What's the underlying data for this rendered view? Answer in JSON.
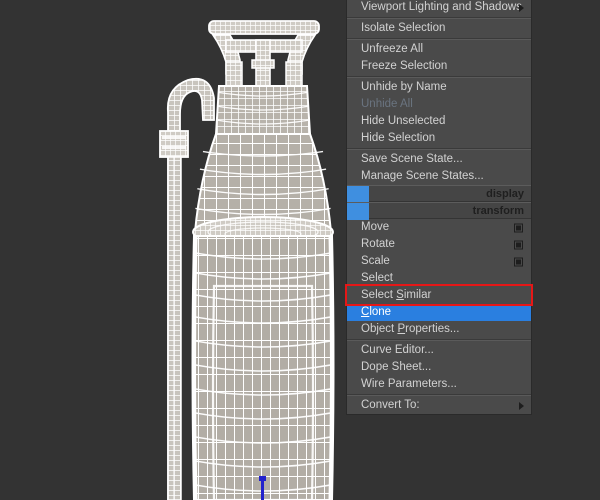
{
  "app": {
    "background_color": "#333333",
    "viewport_name": "perspective-viewport"
  },
  "scene": {
    "object_label": "fire-extinguisher-wireframe",
    "wireframe_color": "#ffffff",
    "shading_color": "#b9b4ac",
    "gizmo_color": "#2222cc"
  },
  "quad_menu": {
    "name": "quad-menu",
    "background_color": "#4a4a4a",
    "highlight_color": "#2a7fe0",
    "annotation_color": "#e61717",
    "groups": [
      {
        "items": [
          {
            "label": "Viewport Lighting and Shadows",
            "icon": "submenu-arrow-icon",
            "state": "normal",
            "accel": ""
          }
        ]
      },
      {
        "items": [
          {
            "label": "Isolate Selection",
            "icon": "",
            "state": "normal",
            "accel": ""
          }
        ]
      },
      {
        "items": [
          {
            "label": "Unfreeze All",
            "icon": "",
            "state": "normal",
            "accel": ""
          },
          {
            "label": "Freeze Selection",
            "icon": "",
            "state": "normal",
            "accel": ""
          }
        ]
      },
      {
        "items": [
          {
            "label": "Unhide by Name",
            "icon": "",
            "state": "normal",
            "accel": ""
          },
          {
            "label": "Unhide All",
            "icon": "",
            "state": "disabled",
            "accel": ""
          },
          {
            "label": "Hide Unselected",
            "icon": "",
            "state": "normal",
            "accel": ""
          },
          {
            "label": "Hide Selection",
            "icon": "",
            "state": "normal",
            "accel": ""
          }
        ]
      },
      {
        "items": [
          {
            "label": "Save Scene State...",
            "icon": "",
            "state": "normal",
            "accel": ""
          },
          {
            "label": "Manage Scene States...",
            "icon": "",
            "state": "normal",
            "accel": ""
          }
        ]
      }
    ],
    "sections": [
      {
        "label": "display",
        "swatch_color": "#3f8fe0"
      },
      {
        "label": "transform",
        "swatch_color": "#3f8fe0"
      }
    ],
    "transform_groups": [
      {
        "items": [
          {
            "label": "Move",
            "icon": "dialog-box-icon",
            "state": "normal",
            "accel": ""
          },
          {
            "label": "Rotate",
            "icon": "dialog-box-icon",
            "state": "normal",
            "accel": ""
          },
          {
            "label": "Scale",
            "icon": "dialog-box-icon",
            "state": "normal",
            "accel": ""
          },
          {
            "label": "Select",
            "icon": "",
            "state": "normal",
            "accel": ""
          },
          {
            "label": "Select Similar",
            "icon": "",
            "state": "normal",
            "accel": "S"
          },
          {
            "label": "Clone",
            "icon": "",
            "state": "highlight",
            "accel": "C"
          },
          {
            "label": "Object Properties...",
            "icon": "",
            "state": "normal",
            "accel": "P"
          }
        ]
      },
      {
        "items": [
          {
            "label": "Curve Editor...",
            "icon": "",
            "state": "normal",
            "accel": ""
          },
          {
            "label": "Dope Sheet...",
            "icon": "",
            "state": "normal",
            "accel": ""
          },
          {
            "label": "Wire Parameters...",
            "icon": "",
            "state": "normal",
            "accel": ""
          }
        ]
      },
      {
        "items": [
          {
            "label": "Convert To:",
            "icon": "submenu-arrow-icon",
            "state": "normal",
            "accel": ""
          }
        ]
      }
    ]
  }
}
